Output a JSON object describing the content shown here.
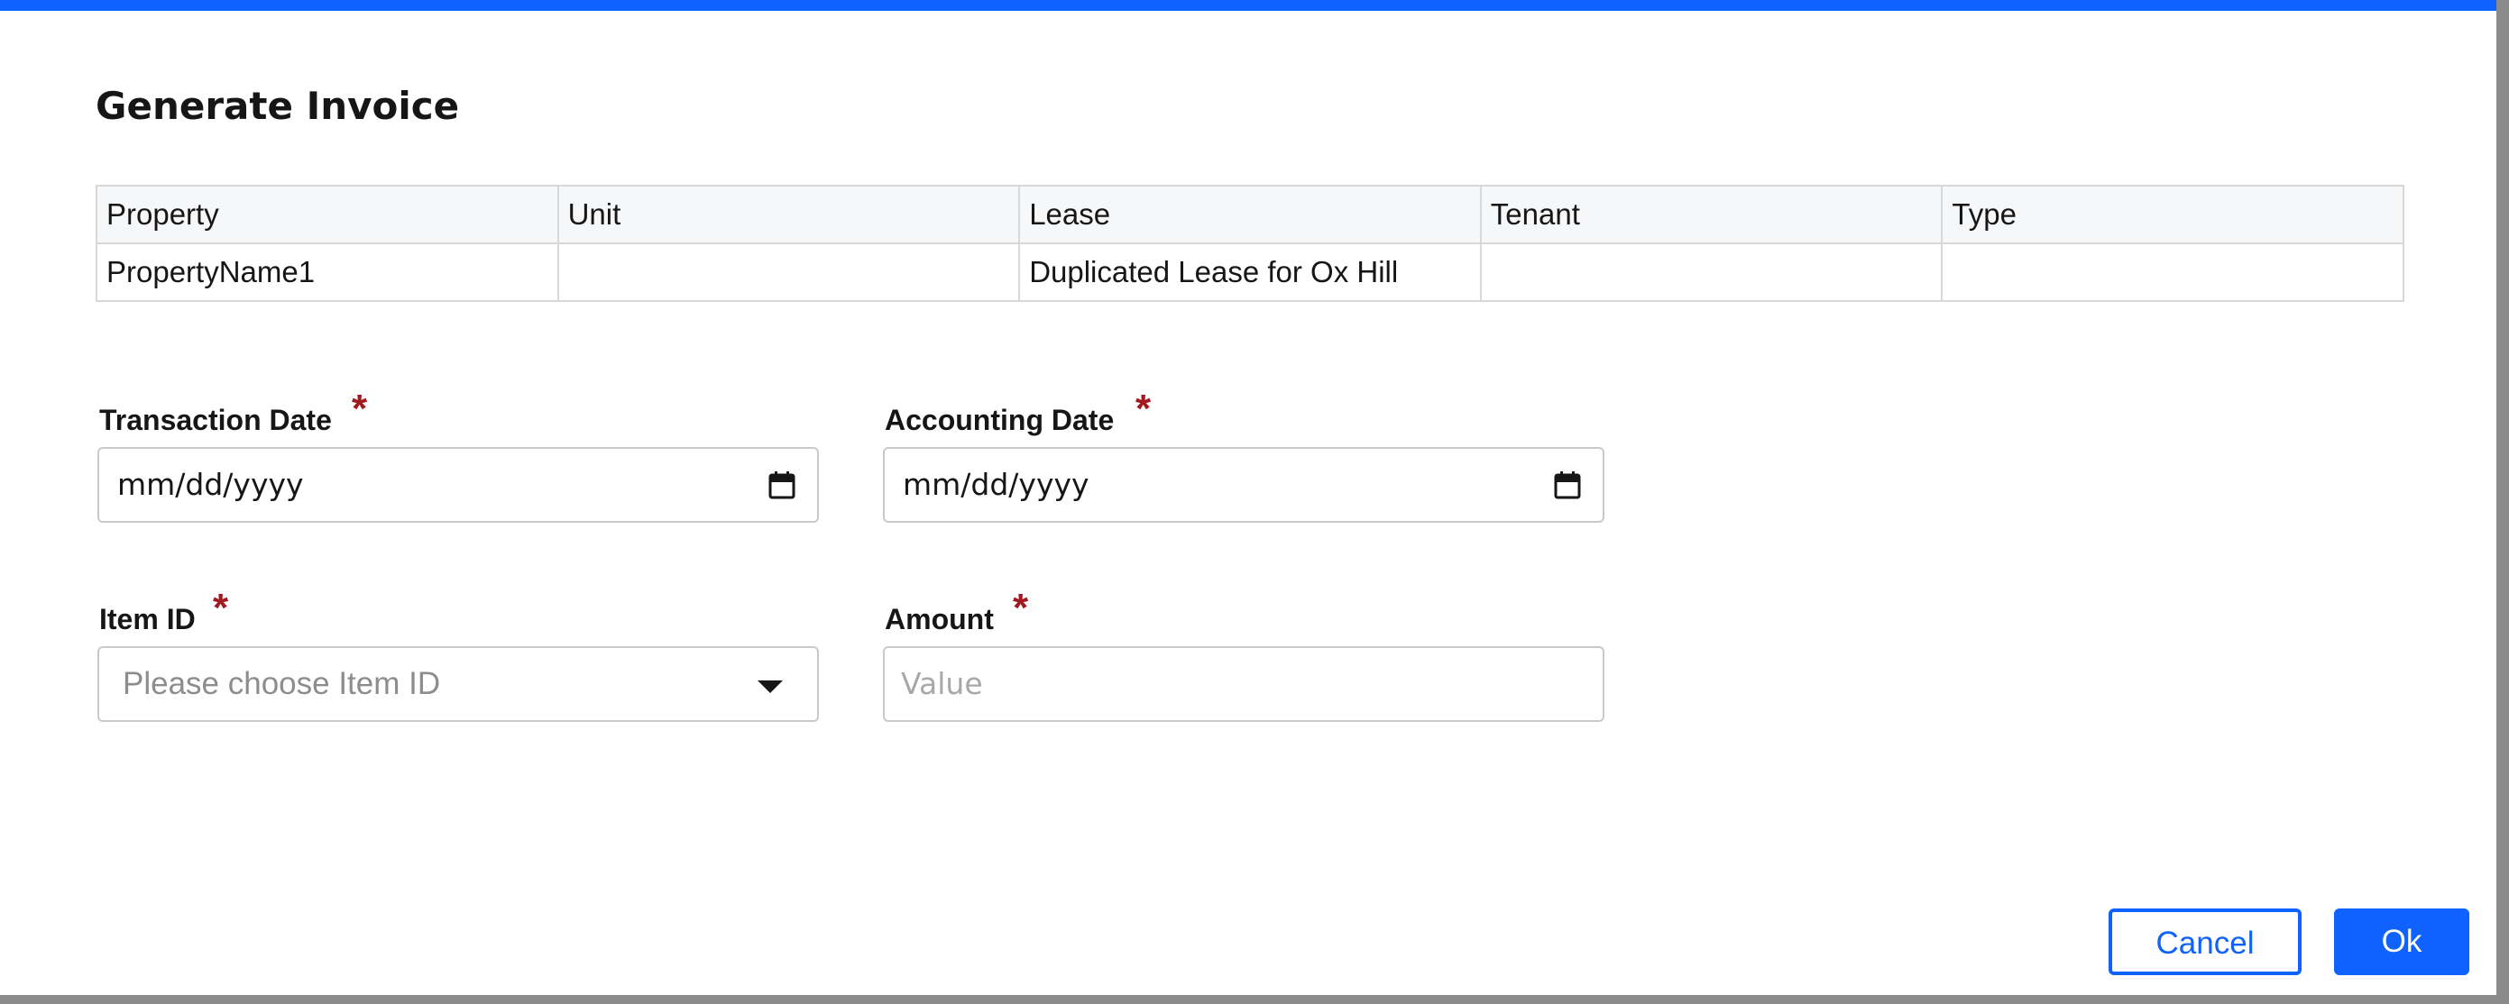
{
  "modal": {
    "title": "Generate Invoice"
  },
  "table": {
    "headers": [
      "Property",
      "Unit",
      "Lease",
      "Tenant",
      "Type"
    ],
    "rows": [
      [
        "PropertyName1",
        "",
        "Duplicated Lease for Ox Hill",
        "",
        ""
      ]
    ]
  },
  "form": {
    "transaction_date": {
      "label": "Transaction Date",
      "required_mark": "*",
      "value": "mm/dd/yyyy",
      "icon": "calendar-icon"
    },
    "accounting_date": {
      "label": "Accounting Date",
      "required_mark": "*",
      "value": "mm/dd/yyyy",
      "icon": "calendar-icon"
    },
    "item_id": {
      "label": "Item ID",
      "required_mark": "*",
      "placeholder": "Please choose Item ID",
      "icon": "caret-down-icon"
    },
    "amount": {
      "label": "Amount",
      "required_mark": "*",
      "placeholder": "Value"
    }
  },
  "actions": {
    "cancel_label": "Cancel",
    "ok_label": "Ok"
  },
  "colors": {
    "accent": "#0f62fe",
    "required": "#a2191f",
    "border": "#c9c9c9",
    "header_bg": "#f6f7f9"
  }
}
